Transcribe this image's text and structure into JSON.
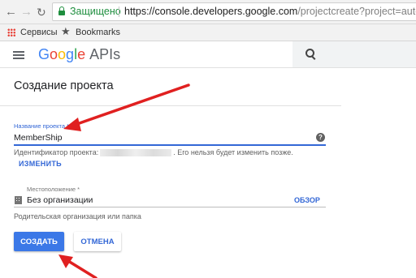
{
  "browser": {
    "security_label": "Защищено",
    "url_host": "https://console.developers.google.com",
    "url_rest": "/projectcreate?project=autoweboffice-",
    "bookmarks": {
      "apps_label": "Сервисы",
      "bookmarks_label": "Bookmarks"
    }
  },
  "header": {
    "logo_letters": [
      "G",
      "o",
      "o",
      "g",
      "l",
      "e"
    ],
    "logo_suffix": "APIs"
  },
  "form": {
    "title": "Создание проекта",
    "name_field": {
      "label": "Название проекта *",
      "value": "MemberShip"
    },
    "project_id": {
      "prefix": "Идентификатор проекта:",
      "suffix": ". Его нельзя будет изменить позже."
    },
    "change_link": "ИЗМЕНИТЬ",
    "location": {
      "label": "Местоположение *",
      "value": "Без организации",
      "browse_label": "ОБЗОР",
      "hint": "Родительская организация или папка"
    },
    "create_label": "СОЗДАТЬ",
    "cancel_label": "ОТМЕНА"
  },
  "colors": {
    "accent": "#3367d6",
    "primary_button": "#3b78e7",
    "annotation_arrow": "#e02020",
    "secure": "#1e8e3e"
  },
  "icons": [
    "back-arrow-icon",
    "forward-arrow-icon",
    "reload-icon",
    "lock-icon",
    "apps-grid-icon",
    "star-icon",
    "menu-icon",
    "search-icon",
    "help-icon",
    "building-icon"
  ]
}
